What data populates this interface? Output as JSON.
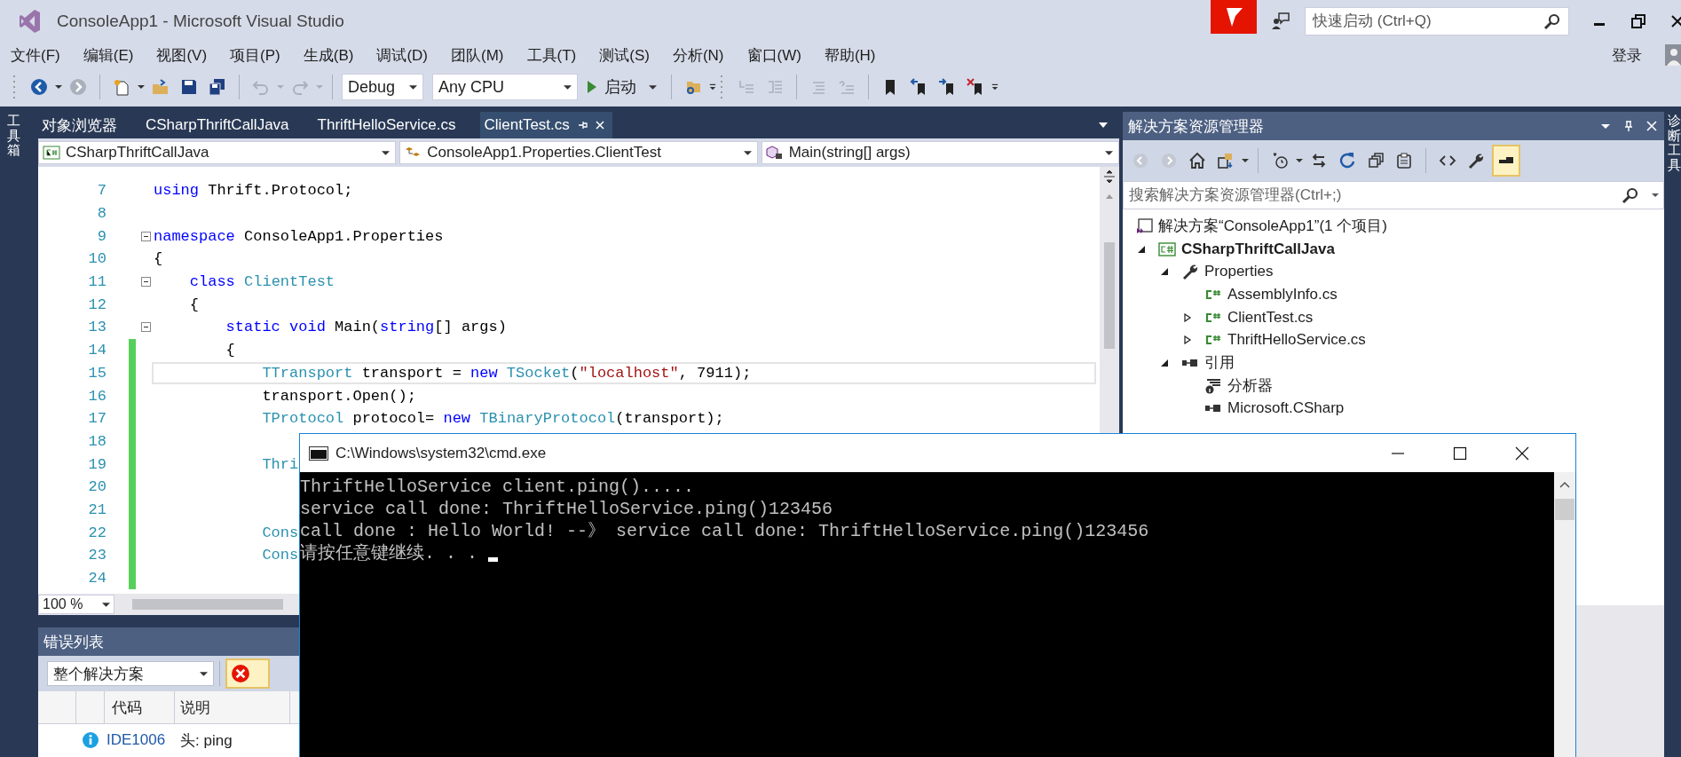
{
  "window": {
    "title": "ConsoleApp1 - Microsoft Visual Studio",
    "quick_launch": {
      "placeholder": "快速启动 (Ctrl+Q)"
    }
  },
  "menu": [
    "文件(F)",
    "编辑(E)",
    "视图(V)",
    "项目(P)",
    "生成(B)",
    "调试(D)",
    "团队(M)",
    "工具(T)",
    "测试(S)",
    "分析(N)",
    "窗口(W)",
    "帮助(H)"
  ],
  "account": "登录",
  "toolbar": {
    "configuration": "Debug",
    "platform": "Any CPU",
    "start": "启动"
  },
  "left_strip": "工具箱",
  "right_strip": "诊断工具",
  "editor": {
    "tabs": [
      {
        "label": "对象浏览器",
        "selected": false
      },
      {
        "label": "CSharpThriftCallJava",
        "selected": false
      },
      {
        "label": "ThriftHelloService.cs",
        "selected": false
      },
      {
        "label": "ClientTest.cs",
        "selected": true
      }
    ],
    "nav": [
      "CSharpThriftCallJava",
      "ConsoleApp1.Properties.ClientTest",
      "Main(string[] args)"
    ],
    "lines": [
      {
        "number": "7",
        "collapsible": false,
        "changed": false,
        "current": false,
        "tokens": [
          {
            "text": "using",
            "kind": "kw"
          },
          {
            "text": " Thrift.Protocol;",
            "kind": "plain"
          }
        ]
      },
      {
        "number": "8",
        "collapsible": false,
        "changed": false,
        "current": false
      },
      {
        "number": "9",
        "collapsible": true,
        "changed": false,
        "current": false,
        "tokens": [
          {
            "text": "namespace",
            "kind": "kw"
          },
          {
            "text": " ConsoleApp1.Properties",
            "kind": "plain"
          }
        ]
      },
      {
        "number": "10",
        "collapsible": false,
        "changed": false,
        "current": false,
        "tokens": [
          {
            "text": "{",
            "kind": "plain"
          }
        ]
      },
      {
        "number": "11",
        "collapsible": true,
        "changed": false,
        "current": false,
        "tokens": [
          {
            "text": "    class",
            "kind": "kw"
          },
          {
            "text": " ClientTest",
            "kind": "type"
          }
        ]
      },
      {
        "number": "12",
        "collapsible": false,
        "changed": false,
        "current": false,
        "tokens": [
          {
            "text": "    {",
            "kind": "plain"
          }
        ]
      },
      {
        "number": "13",
        "collapsible": true,
        "changed": false,
        "current": false,
        "tokens": [
          {
            "text": "        static void",
            "kind": "kw"
          },
          {
            "text": " Main(",
            "kind": "plain"
          },
          {
            "text": "string",
            "kind": "kw"
          },
          {
            "text": "[] args)",
            "kind": "plain"
          }
        ]
      },
      {
        "number": "14",
        "collapsible": false,
        "changed": true,
        "current": false,
        "tokens": [
          {
            "text": "        {",
            "kind": "plain"
          }
        ]
      },
      {
        "number": "15",
        "collapsible": false,
        "changed": true,
        "current": true,
        "tokens": [
          {
            "text": "            TTransport",
            "kind": "type"
          },
          {
            "text": " transport = ",
            "kind": "plain"
          },
          {
            "text": "new",
            "kind": "kw"
          },
          {
            "text": " TSocket",
            "kind": "type"
          },
          {
            "text": "(",
            "kind": "plain"
          },
          {
            "text": "\"localhost\"",
            "kind": "str"
          },
          {
            "text": ", 7911);",
            "kind": "plain"
          }
        ]
      },
      {
        "number": "16",
        "collapsible": false,
        "changed": true,
        "current": false,
        "tokens": [
          {
            "text": "            transport.Open();",
            "kind": "plain"
          }
        ]
      },
      {
        "number": "17",
        "collapsible": false,
        "changed": true,
        "current": false,
        "tokens": [
          {
            "text": "            TProtocol",
            "kind": "type"
          },
          {
            "text": " protocol= ",
            "kind": "plain"
          },
          {
            "text": "new",
            "kind": "kw"
          },
          {
            "text": " TBinaryProtocol",
            "kind": "type"
          },
          {
            "text": "(transport);",
            "kind": "plain"
          }
        ]
      },
      {
        "number": "18",
        "collapsible": false,
        "changed": true,
        "current": false
      },
      {
        "number": "19",
        "collapsible": false,
        "changed": true,
        "current": false,
        "tokens": [
          {
            "text": "            Thri",
            "kind": "type"
          }
        ]
      },
      {
        "number": "20",
        "collapsible": false,
        "changed": true,
        "current": false
      },
      {
        "number": "21",
        "collapsible": false,
        "changed": true,
        "current": false
      },
      {
        "number": "22",
        "collapsible": false,
        "changed": true,
        "current": false,
        "tokens": [
          {
            "text": "            Cons",
            "kind": "type"
          }
        ]
      },
      {
        "number": "23",
        "collapsible": false,
        "changed": true,
        "current": false,
        "tokens": [
          {
            "text": "            Cons",
            "kind": "type"
          }
        ]
      },
      {
        "number": "24",
        "collapsible": false,
        "changed": true,
        "current": false
      }
    ],
    "zoom": "100 %"
  },
  "error_list": {
    "title": "错误列表",
    "scope": "整个解决方案",
    "columns": [
      "代码",
      "说明"
    ],
    "rows": [
      {
        "code": "IDE1006",
        "description": "头: ping"
      }
    ]
  },
  "solution_explorer": {
    "title": "解决方案资源管理器",
    "preview": {
      "selected": true
    },
    "search": {
      "placeholder": "搜索解决方案资源管理器(Ctrl+;)"
    },
    "tree": [
      {
        "label": "解决方案“ConsoleApp1”(1 个项目)",
        "kind": "solution",
        "children": [
          {
            "label": "CSharpThriftCallJava",
            "kind": "project",
            "expanded": true,
            "children": [
              {
                "label": "Properties",
                "kind": "properties",
                "expanded": true,
                "children": [
                  {
                    "label": "AssemblyInfo.cs",
                    "kind": "cs"
                  },
                  {
                    "label": "ClientTest.cs",
                    "kind": "cs",
                    "expanded": false
                  },
                  {
                    "label": "ThriftHelloService.cs",
                    "kind": "cs",
                    "expanded": false
                  }
                ]
              },
              {
                "label": "引用",
                "kind": "references",
                "expanded": true,
                "children": [
                  {
                    "label": "分析器",
                    "kind": "analyzer"
                  },
                  {
                    "label": "Microsoft.CSharp",
                    "kind": "reference"
                  }
                ]
              }
            ]
          }
        ]
      }
    ]
  },
  "console": {
    "title": "C:\\Windows\\system32\\cmd.exe",
    "lines": [
      "ThriftHelloService client.ping().....",
      "service call done: ThriftHelloService.ping()123456",
      "call done : Hello World! --》 service call done: ThriftHelloService.ping()123456",
      "请按任意键继续. . ."
    ]
  }
}
